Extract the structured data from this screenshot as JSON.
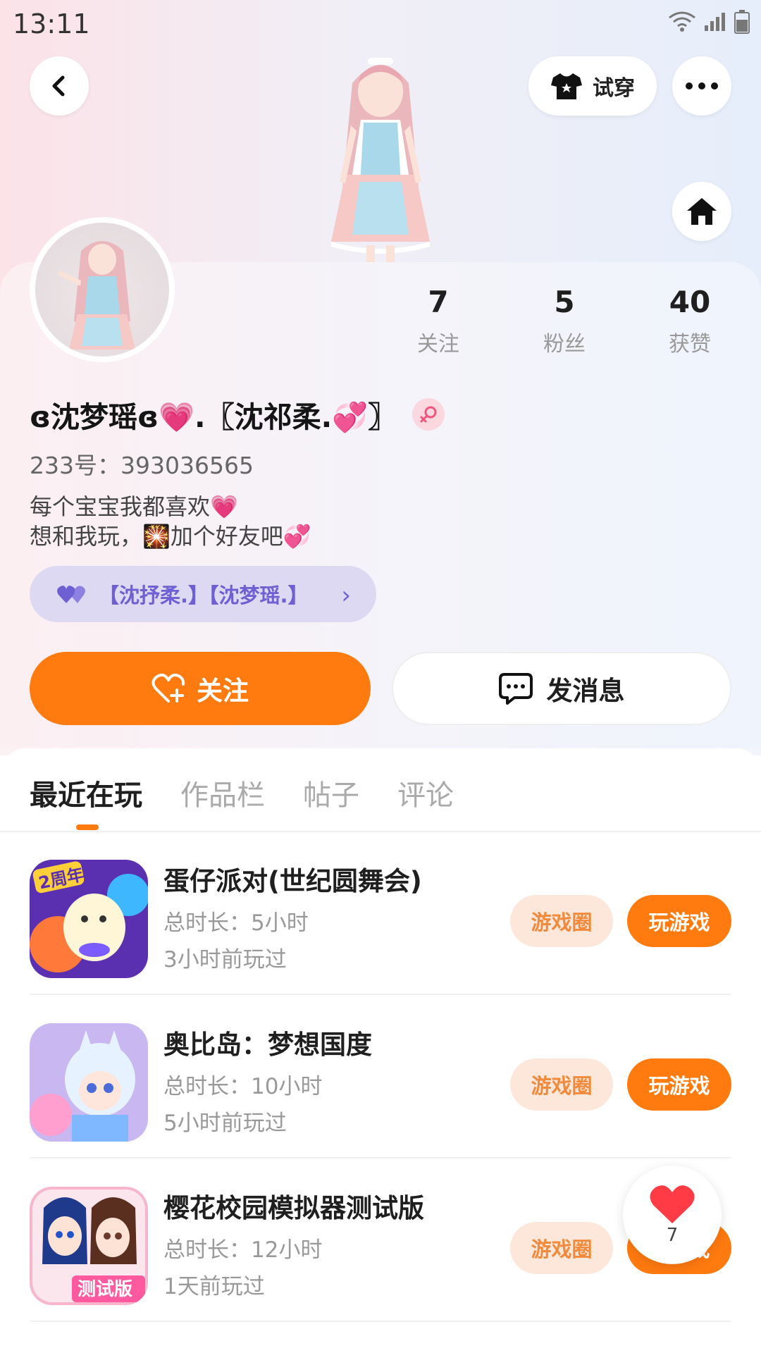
{
  "status_bar": {
    "time": "13:11"
  },
  "header": {
    "tryon_label": "试穿"
  },
  "stats": [
    {
      "value": "7",
      "label": "关注"
    },
    {
      "value": "5",
      "label": "粉丝"
    },
    {
      "value": "40",
      "label": "获赞"
    }
  ],
  "profile": {
    "name": "ɞ沈梦瑶ɞ💗.〖沈祁柔.💞〗",
    "uid": "233号：393036565",
    "bio": "每个宝宝我都喜欢💗\n想和我玩，🎇加个好友吧💞",
    "relation": "【沈抒柔.】【沈梦瑶.】"
  },
  "actions": {
    "follow_label": "关注",
    "message_label": "发消息"
  },
  "tabs": [
    {
      "label": "最近在玩",
      "active": true
    },
    {
      "label": "作品栏",
      "active": false
    },
    {
      "label": "帖子",
      "active": false
    },
    {
      "label": "评论",
      "active": false
    }
  ],
  "games": [
    {
      "title": "蛋仔派对(世纪圆舞会)",
      "duration": "总时长：5小时",
      "last_played": "3小时前玩过",
      "icon": "eggy-party-icon",
      "icon_badge": "2周年"
    },
    {
      "title": "奥比岛：梦想国度",
      "duration": "总时长：10小时",
      "last_played": "5小时前玩过",
      "icon": "aobi-island-icon"
    },
    {
      "title": "樱花校园模拟器测试版",
      "duration": "总时长：12小时",
      "last_played": "1天前玩过",
      "icon": "sakura-school-icon",
      "icon_badge": "测试版"
    }
  ],
  "game_buttons": {
    "circle_label": "游戏圈",
    "play_label": "玩游戏"
  },
  "like_float": {
    "count": "7"
  },
  "colors": {
    "accent": "#ff7a0f",
    "relation": "#6e5fd2",
    "circle_tag_bg": "#fde7db"
  }
}
